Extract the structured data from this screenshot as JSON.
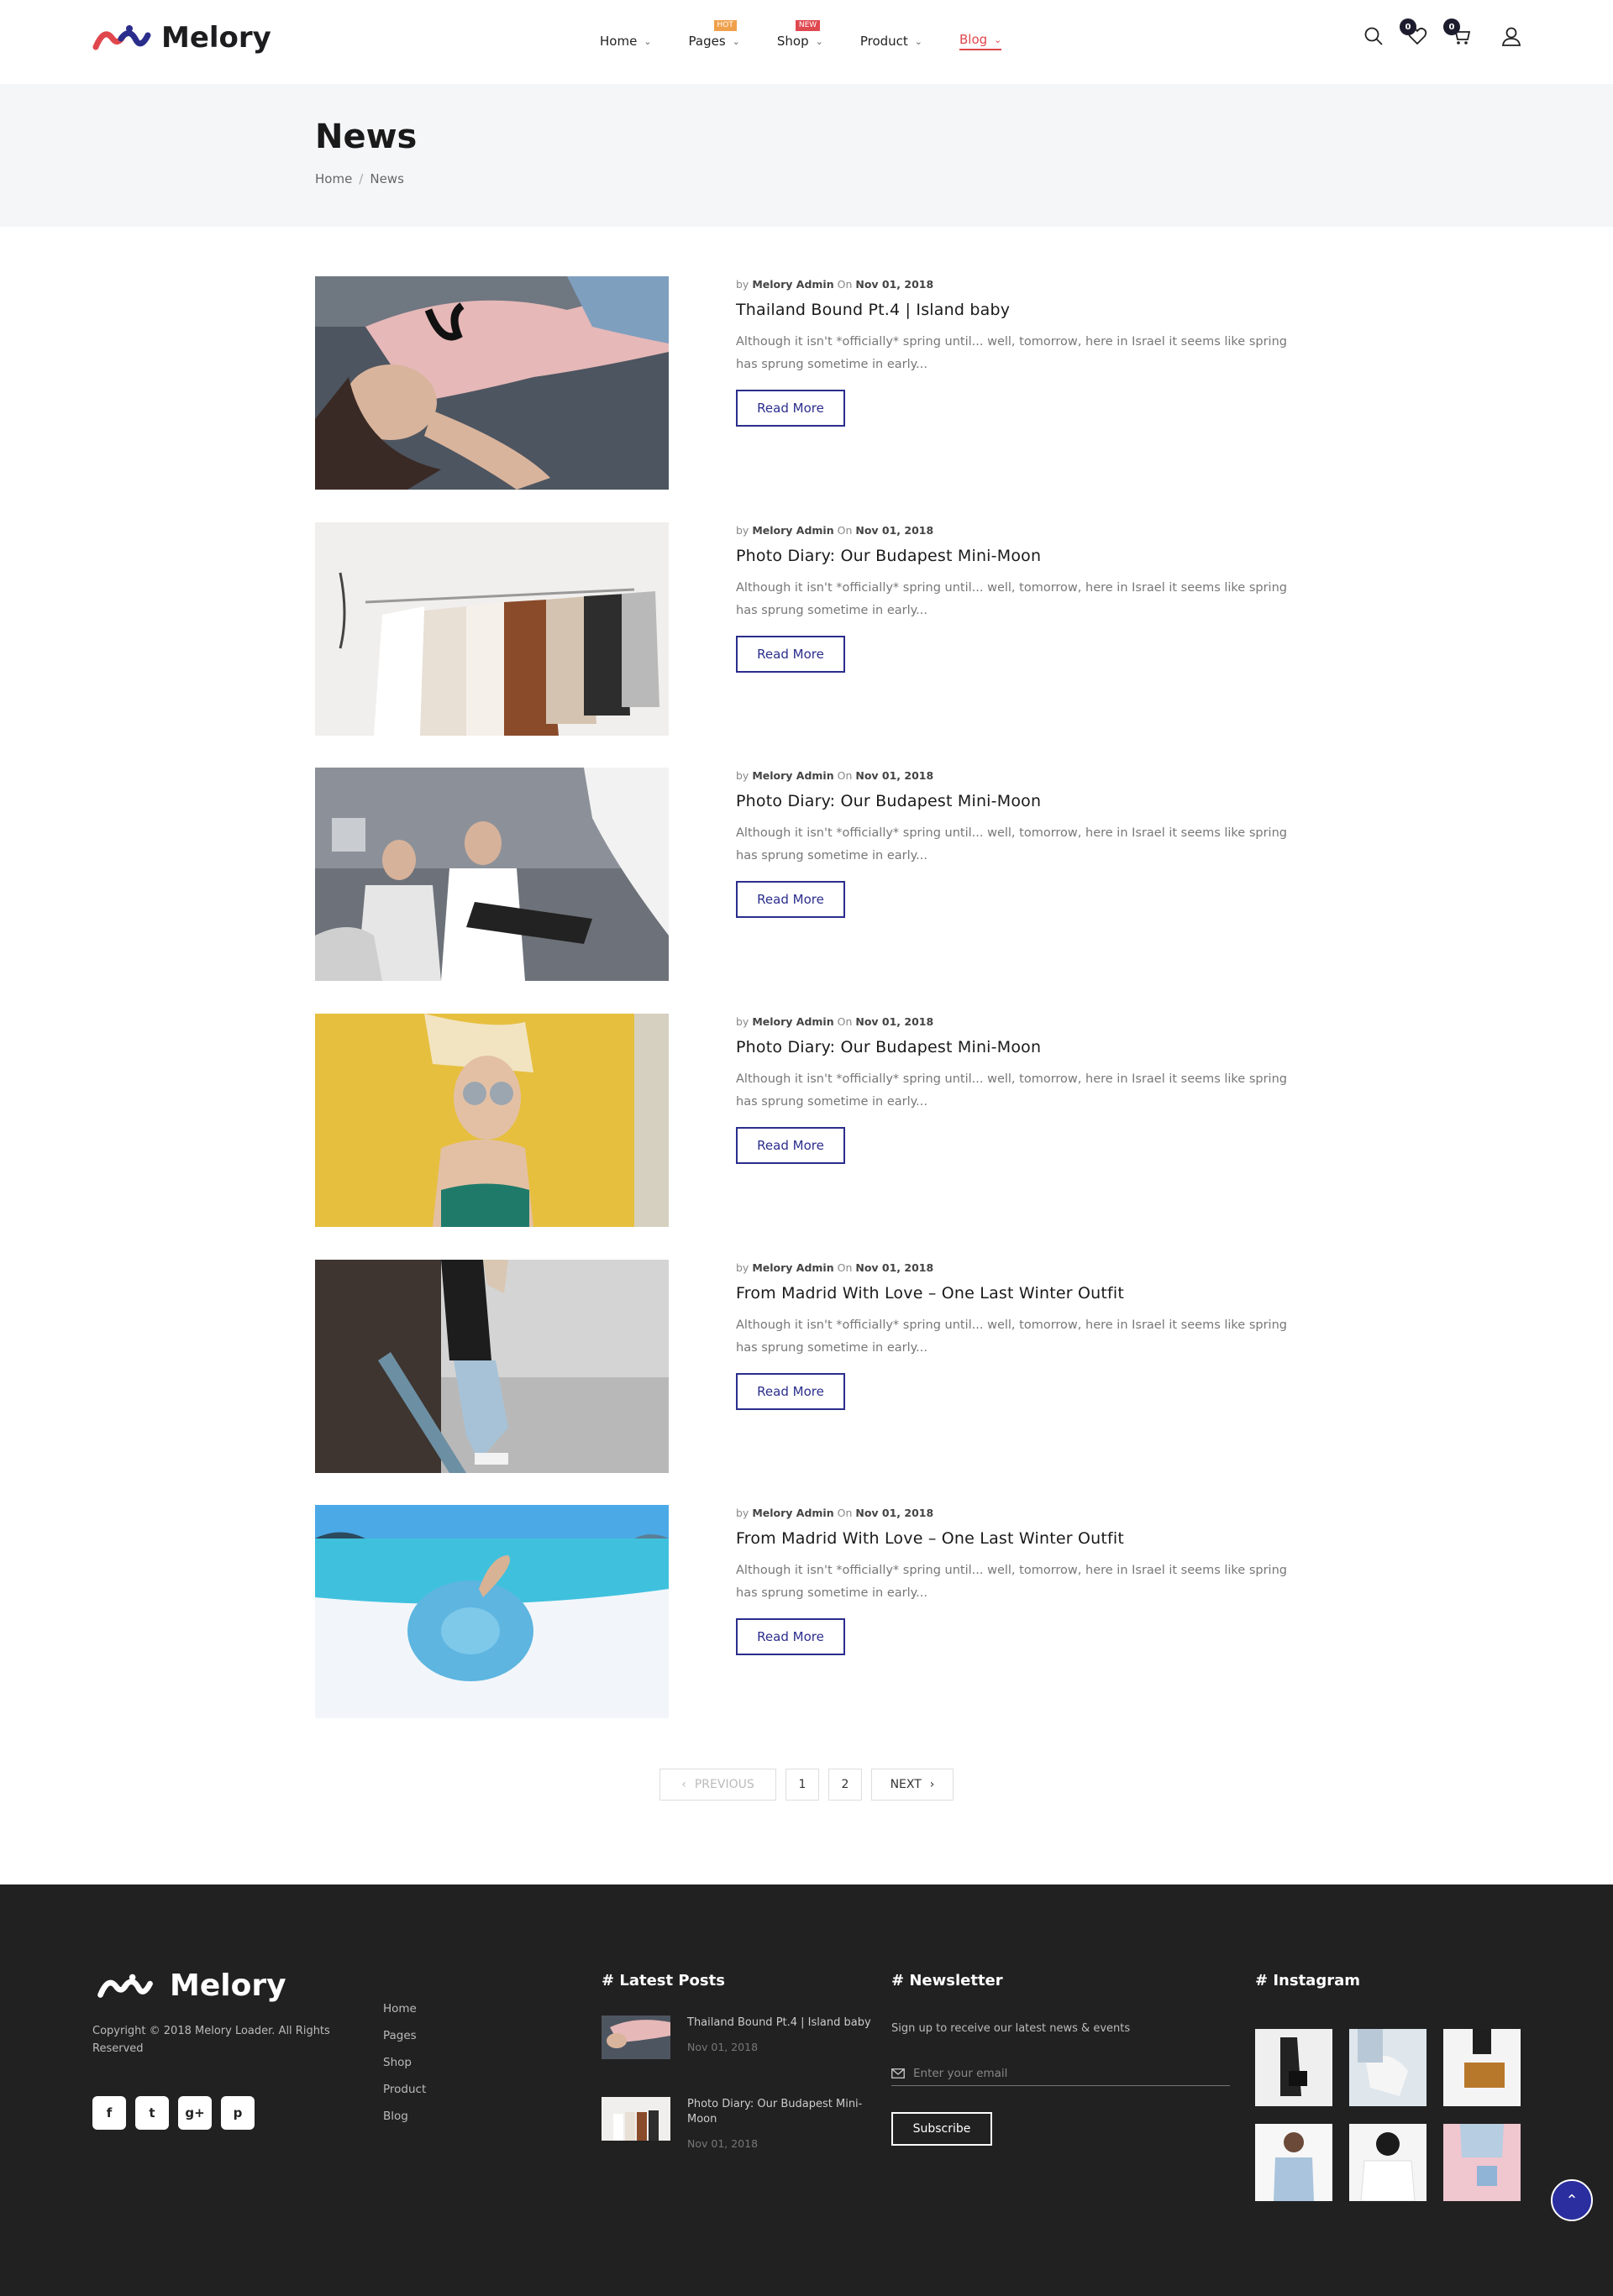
{
  "header": {
    "logo_text": "Melory",
    "nav": [
      {
        "label": "Home",
        "badge": ""
      },
      {
        "label": "Pages",
        "badge": "HOT"
      },
      {
        "label": "Shop",
        "badge": "NEW"
      },
      {
        "label": "Product",
        "badge": ""
      },
      {
        "label": "Blog",
        "badge": ""
      }
    ],
    "wishlist_count": "0",
    "cart_count": "0"
  },
  "banner": {
    "title": "News",
    "breadcrumb": [
      "Home",
      "/",
      "News"
    ]
  },
  "posts": [
    {
      "by": "by",
      "author": "Melory Admin",
      "on": "On",
      "date": "Nov 01, 2018",
      "title": "Thailand Bound Pt.4 | Island baby",
      "excerpt": "Although it isn't *officially* spring until... well, tomorrow, here in Israel it seems like spring has sprung sometime in early...",
      "button": "Read More"
    },
    {
      "by": "by",
      "author": "Melory Admin",
      "on": "On",
      "date": "Nov 01, 2018",
      "title": "Photo Diary: Our Budapest Mini-Moon",
      "excerpt": "Although it isn't *officially* spring until... well, tomorrow, here in Israel it seems like spring has sprung sometime in early...",
      "button": "Read More"
    },
    {
      "by": "by",
      "author": "Melory Admin",
      "on": "On",
      "date": "Nov 01, 2018",
      "title": "Photo Diary: Our Budapest Mini-Moon",
      "excerpt": "Although it isn't *officially* spring until... well, tomorrow, here in Israel it seems like spring has sprung sometime in early...",
      "button": "Read More"
    },
    {
      "by": "by",
      "author": "Melory Admin",
      "on": "On",
      "date": "Nov 01, 2018",
      "title": "Photo Diary: Our Budapest Mini-Moon",
      "excerpt": "Although it isn't *officially* spring until... well, tomorrow, here in Israel it seems like spring has sprung sometime in early...",
      "button": "Read More"
    },
    {
      "by": "by",
      "author": "Melory Admin",
      "on": "On",
      "date": "Nov 01, 2018",
      "title": "From Madrid With Love – One Last Winter Outfit",
      "excerpt": "Although it isn't *officially* spring until... well, tomorrow, here in Israel it seems like spring has sprung sometime in early...",
      "button": "Read More"
    },
    {
      "by": "by",
      "author": "Melory Admin",
      "on": "On",
      "date": "Nov 01, 2018",
      "title": "From Madrid With Love – One Last Winter Outfit",
      "excerpt": "Although it isn't *officially* spring until... well, tomorrow, here in Israel it seems like spring has sprung sometime in early...",
      "button": "Read More"
    }
  ],
  "pagination": {
    "prev": "PREVIOUS",
    "pages": [
      "1",
      "2"
    ],
    "next": "NEXT"
  },
  "footer": {
    "logo_text": "Melory",
    "copyright": "Copyright © 2018 Melory Loader. All Rights Reserved",
    "socials": [
      "f",
      "t",
      "g+",
      "p"
    ],
    "links": [
      "Home",
      "Pages",
      "Shop",
      "Product",
      "Blog"
    ],
    "latest_title": "# Latest Posts",
    "latest_posts": [
      {
        "title": "Thailand Bound Pt.4 | Island baby",
        "date": "Nov 01, 2018"
      },
      {
        "title": "Photo Diary: Our Budapest Mini-Moon",
        "date": "Nov 01, 2018"
      }
    ],
    "newsletter_title": "# Newsletter",
    "newsletter_text": "Sign up to receive our latest news & events",
    "email_placeholder": "Enter your email",
    "subscribe_label": "Subscribe",
    "instagram_title": "# Instagram"
  },
  "colors": {
    "accent": "#2b2d8c",
    "blog_active": "#e0474c",
    "footer_bg": "#212121",
    "banner_bg": "#f5f6f8"
  }
}
